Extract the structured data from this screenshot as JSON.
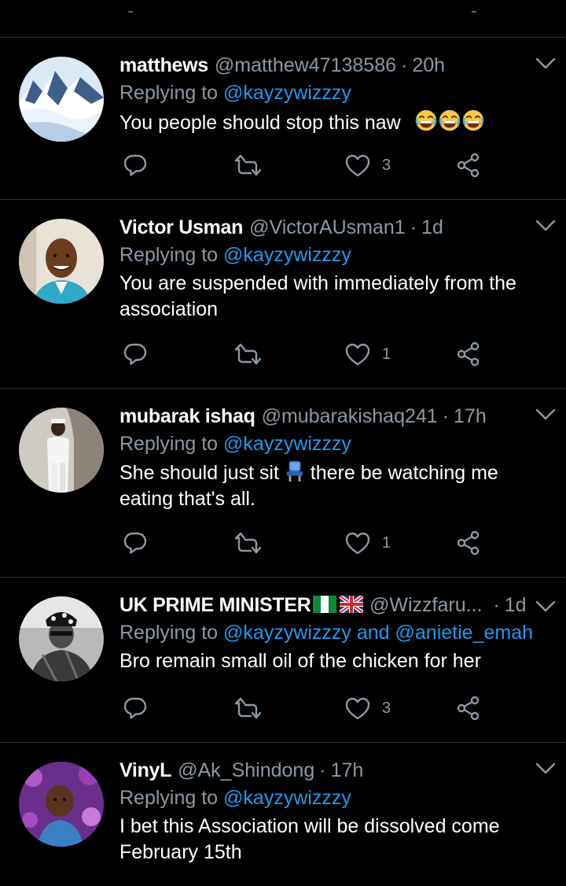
{
  "tweets": [
    {
      "name": "matthews",
      "handle": "@matthew47138586",
      "time": "20h",
      "replying_prefix": "Replying to ",
      "replying_to": "@kayzywizzzy",
      "text": "You people should stop this naw",
      "emoji": "😂😂😂",
      "likes": "3"
    },
    {
      "name": "Victor Usman",
      "handle": "@VictorAUsman1",
      "time": "1d",
      "replying_prefix": "Replying to ",
      "replying_to": "@kayzywizzzy",
      "text": "You are suspended with immediately from the association",
      "likes": "1"
    },
    {
      "name": "mubarak ishaq",
      "handle": "@mubarakishaq241",
      "time": "17h",
      "replying_prefix": "Replying to ",
      "replying_to": "@kayzywizzzy",
      "text_before": "She should just sit",
      "text_after": " there be watching me eating that's all.",
      "likes": "1"
    },
    {
      "name": "UK PRIME MINISTER",
      "handle": "@Wizzfaru...",
      "time": "1d",
      "replying_prefix": "Replying to ",
      "replying_to": "@kayzywizzzy and @anietie_emah",
      "text": "Bro remain small oil of the chicken for her",
      "likes": "3"
    },
    {
      "name": "VinyL",
      "handle": "@Ak_Shindong",
      "time": "17h",
      "replying_prefix": "Replying to ",
      "replying_to": "@kayzywizzzy",
      "text": "I bet this Association will be dissolved come February 15th"
    }
  ],
  "colors": {
    "background": "#000000",
    "muted": "#8b98a5",
    "link": "#1d9bf0",
    "divider": "#2f3336"
  },
  "icons": [
    "reply-icon",
    "retweet-icon",
    "like-icon",
    "share-icon",
    "chevron-down-icon",
    "chair-emoji",
    "laughing-emoji",
    "nigeria-flag-icon",
    "uk-flag-icon"
  ]
}
